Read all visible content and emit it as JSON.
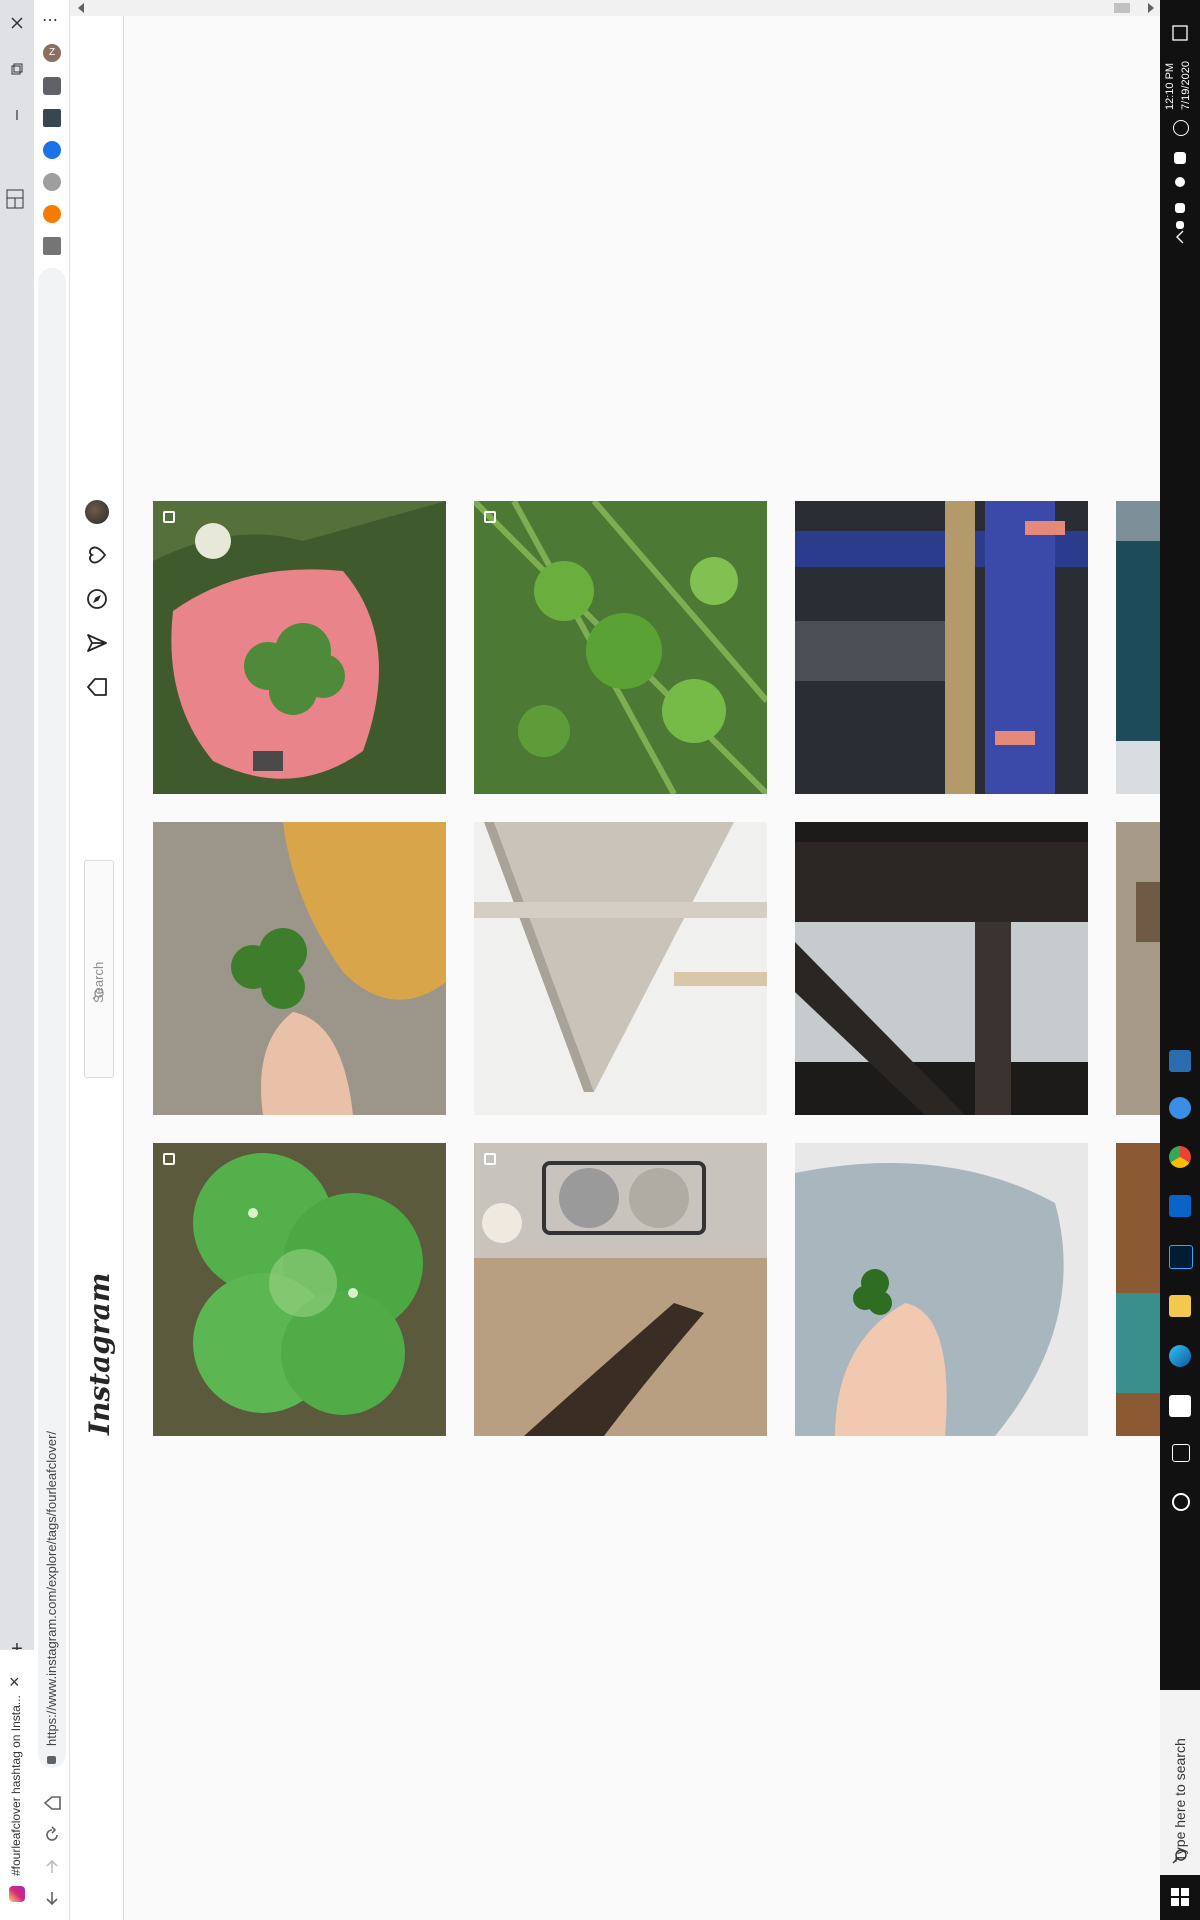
{
  "browser": {
    "tab_title": "#fourleafclover hashtag on Insta...",
    "url": "https://www.instagram.com/explore/tags/fourleafclover/",
    "new_tab_symbol": "+",
    "close_symbol": "×",
    "menu_symbol": "⋯",
    "profile_initial": "Z"
  },
  "instagram": {
    "logo": "Instagram",
    "search_placeholder": "Search"
  },
  "grid": {
    "posts": [
      {
        "alt": "Hand holding a four-leaf clover",
        "multi": true
      },
      {
        "alt": "Clovers growing in grass",
        "multi": true
      },
      {
        "alt": "Glass railing with blue tiles",
        "multi": false
      },
      {
        "alt": "Partial post",
        "multi": false
      },
      {
        "alt": "Fingers holding a four-leaf clover over orange lichen",
        "multi": false
      },
      {
        "alt": "Grey shelf corner",
        "multi": false
      },
      {
        "alt": "Dark wooden frame corner",
        "multi": false
      },
      {
        "alt": "Partial post",
        "multi": false
      },
      {
        "alt": "Close-up of a clover with water drops",
        "multi": true
      },
      {
        "alt": "Pet bowls and a shadow",
        "multi": true
      },
      {
        "alt": "Fingers holding a tiny clover",
        "multi": false
      },
      {
        "alt": "Partial post",
        "multi": false
      }
    ]
  },
  "taskbar": {
    "time": "12:10 PM",
    "date": "7/19/2020",
    "search_placeholder": "Type here to search"
  },
  "colors": {
    "ig_border": "#dbdbdb",
    "taskbar": "#111111",
    "tabstrip": "#dfe1e5"
  }
}
